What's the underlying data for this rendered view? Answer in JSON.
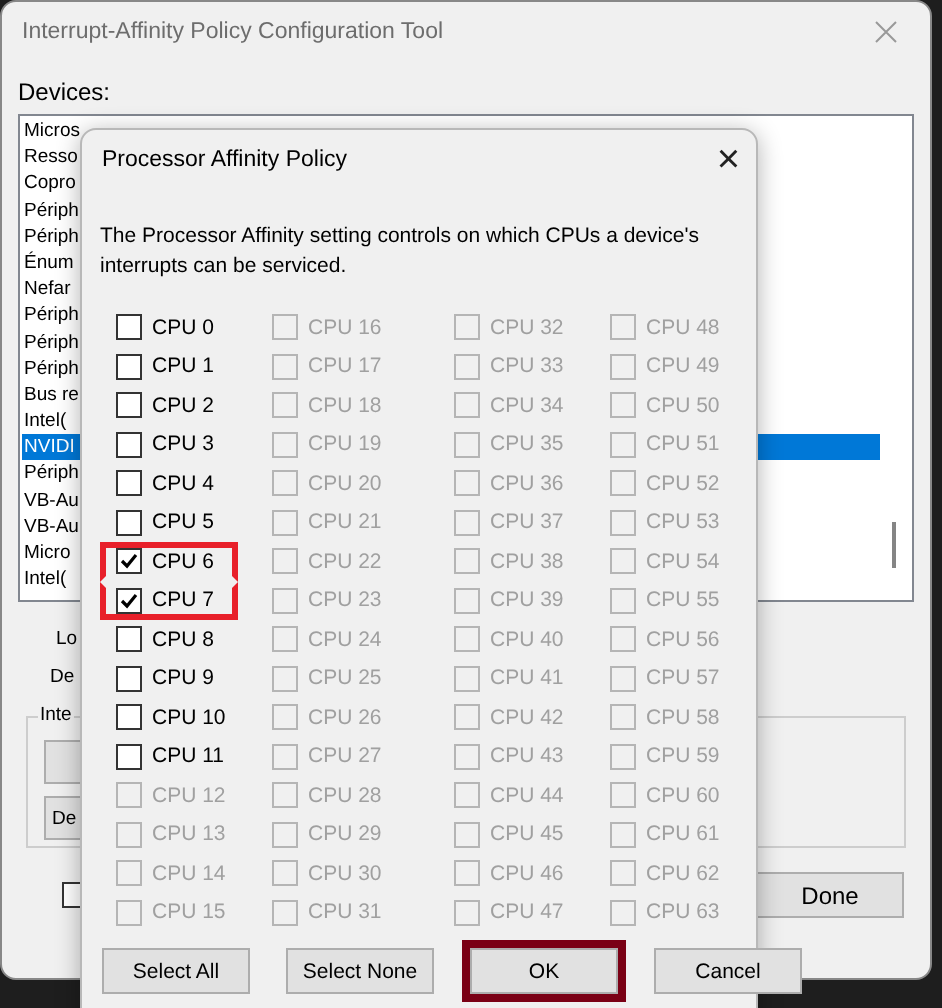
{
  "window": {
    "title": "Interrupt-Affinity Policy Configuration Tool"
  },
  "devices": {
    "label": "Devices:",
    "items": [
      {
        "text": "Micros",
        "selected": false
      },
      {
        "text": "Resso",
        "selected": false
      },
      {
        "text": "Copro",
        "selected": false
      },
      {
        "text": "Périph",
        "selected": false
      },
      {
        "text": "Périph",
        "selected": false
      },
      {
        "text": "Énum",
        "selected": false
      },
      {
        "text": "Nefar",
        "selected": false
      },
      {
        "text": "Périph",
        "selected": false
      },
      {
        "text": "Périph",
        "selected": false
      },
      {
        "text": "Périph",
        "selected": false
      },
      {
        "text": "Bus re",
        "selected": false
      },
      {
        "text": "Intel(",
        "selected": false
      },
      {
        "text": "NVIDI",
        "selected": true
      },
      {
        "text": "Périph",
        "selected": false
      },
      {
        "text": "VB-Au",
        "selected": false
      },
      {
        "text": "VB-Au",
        "selected": false
      },
      {
        "text": "Micro",
        "selected": false
      },
      {
        "text": "Intel(",
        "selected": false
      }
    ]
  },
  "labels": [
    "Lo",
    "De"
  ],
  "group": {
    "legend": "Inte",
    "buttons": [
      {
        "kind": "blank"
      },
      {
        "kind": "text",
        "label": "De"
      }
    ]
  },
  "bottom_checkbox": {
    "checked": false
  },
  "done_button": "Done",
  "dialog": {
    "title": "Processor Affinity Policy",
    "close": "×",
    "description": "The Processor Affinity setting controls on which CPUs a device's interrupts can be serviced.",
    "cpus": [
      {
        "label": "CPU 0",
        "checked": false,
        "disabled": false,
        "highlighted": false
      },
      {
        "label": "CPU 1",
        "checked": false,
        "disabled": false,
        "highlighted": false
      },
      {
        "label": "CPU 2",
        "checked": false,
        "disabled": false,
        "highlighted": false
      },
      {
        "label": "CPU 3",
        "checked": false,
        "disabled": false,
        "highlighted": false
      },
      {
        "label": "CPU 4",
        "checked": false,
        "disabled": false,
        "highlighted": false
      },
      {
        "label": "CPU 5",
        "checked": false,
        "disabled": false,
        "highlighted": false
      },
      {
        "label": "CPU 6",
        "checked": true,
        "disabled": false,
        "highlighted": true
      },
      {
        "label": "CPU 7",
        "checked": true,
        "disabled": false,
        "highlighted": true
      },
      {
        "label": "CPU 8",
        "checked": false,
        "disabled": false,
        "highlighted": false
      },
      {
        "label": "CPU 9",
        "checked": false,
        "disabled": false,
        "highlighted": false
      },
      {
        "label": "CPU 10",
        "checked": false,
        "disabled": false,
        "highlighted": false
      },
      {
        "label": "CPU 11",
        "checked": false,
        "disabled": false,
        "highlighted": false
      },
      {
        "label": "CPU 12",
        "checked": false,
        "disabled": true,
        "highlighted": false
      },
      {
        "label": "CPU 13",
        "checked": false,
        "disabled": true,
        "highlighted": false
      },
      {
        "label": "CPU 14",
        "checked": false,
        "disabled": true,
        "highlighted": false
      },
      {
        "label": "CPU 15",
        "checked": false,
        "disabled": true,
        "highlighted": false
      },
      {
        "label": "CPU 16",
        "checked": false,
        "disabled": true,
        "highlighted": false
      },
      {
        "label": "CPU 17",
        "checked": false,
        "disabled": true,
        "highlighted": false
      },
      {
        "label": "CPU 18",
        "checked": false,
        "disabled": true,
        "highlighted": false
      },
      {
        "label": "CPU 19",
        "checked": false,
        "disabled": true,
        "highlighted": false
      },
      {
        "label": "CPU 20",
        "checked": false,
        "disabled": true,
        "highlighted": false
      },
      {
        "label": "CPU 21",
        "checked": false,
        "disabled": true,
        "highlighted": false
      },
      {
        "label": "CPU 22",
        "checked": false,
        "disabled": true,
        "highlighted": false
      },
      {
        "label": "CPU 23",
        "checked": false,
        "disabled": true,
        "highlighted": false
      },
      {
        "label": "CPU 24",
        "checked": false,
        "disabled": true,
        "highlighted": false
      },
      {
        "label": "CPU 25",
        "checked": false,
        "disabled": true,
        "highlighted": false
      },
      {
        "label": "CPU 26",
        "checked": false,
        "disabled": true,
        "highlighted": false
      },
      {
        "label": "CPU 27",
        "checked": false,
        "disabled": true,
        "highlighted": false
      },
      {
        "label": "CPU 28",
        "checked": false,
        "disabled": true,
        "highlighted": false
      },
      {
        "label": "CPU 29",
        "checked": false,
        "disabled": true,
        "highlighted": false
      },
      {
        "label": "CPU 30",
        "checked": false,
        "disabled": true,
        "highlighted": false
      },
      {
        "label": "CPU 31",
        "checked": false,
        "disabled": true,
        "highlighted": false
      },
      {
        "label": "CPU 32",
        "checked": false,
        "disabled": true,
        "highlighted": false
      },
      {
        "label": "CPU 33",
        "checked": false,
        "disabled": true,
        "highlighted": false
      },
      {
        "label": "CPU 34",
        "checked": false,
        "disabled": true,
        "highlighted": false
      },
      {
        "label": "CPU 35",
        "checked": false,
        "disabled": true,
        "highlighted": false
      },
      {
        "label": "CPU 36",
        "checked": false,
        "disabled": true,
        "highlighted": false
      },
      {
        "label": "CPU 37",
        "checked": false,
        "disabled": true,
        "highlighted": false
      },
      {
        "label": "CPU 38",
        "checked": false,
        "disabled": true,
        "highlighted": false
      },
      {
        "label": "CPU 39",
        "checked": false,
        "disabled": true,
        "highlighted": false
      },
      {
        "label": "CPU 40",
        "checked": false,
        "disabled": true,
        "highlighted": false
      },
      {
        "label": "CPU 41",
        "checked": false,
        "disabled": true,
        "highlighted": false
      },
      {
        "label": "CPU 42",
        "checked": false,
        "disabled": true,
        "highlighted": false
      },
      {
        "label": "CPU 43",
        "checked": false,
        "disabled": true,
        "highlighted": false
      },
      {
        "label": "CPU 44",
        "checked": false,
        "disabled": true,
        "highlighted": false
      },
      {
        "label": "CPU 45",
        "checked": false,
        "disabled": true,
        "highlighted": false
      },
      {
        "label": "CPU 46",
        "checked": false,
        "disabled": true,
        "highlighted": false
      },
      {
        "label": "CPU 47",
        "checked": false,
        "disabled": true,
        "highlighted": false
      },
      {
        "label": "CPU 48",
        "checked": false,
        "disabled": true,
        "highlighted": false
      },
      {
        "label": "CPU 49",
        "checked": false,
        "disabled": true,
        "highlighted": false
      },
      {
        "label": "CPU 50",
        "checked": false,
        "disabled": true,
        "highlighted": false
      },
      {
        "label": "CPU 51",
        "checked": false,
        "disabled": true,
        "highlighted": false
      },
      {
        "label": "CPU 52",
        "checked": false,
        "disabled": true,
        "highlighted": false
      },
      {
        "label": "CPU 53",
        "checked": false,
        "disabled": true,
        "highlighted": false
      },
      {
        "label": "CPU 54",
        "checked": false,
        "disabled": true,
        "highlighted": false
      },
      {
        "label": "CPU 55",
        "checked": false,
        "disabled": true,
        "highlighted": false
      },
      {
        "label": "CPU 56",
        "checked": false,
        "disabled": true,
        "highlighted": false
      },
      {
        "label": "CPU 57",
        "checked": false,
        "disabled": true,
        "highlighted": false
      },
      {
        "label": "CPU 58",
        "checked": false,
        "disabled": true,
        "highlighted": false
      },
      {
        "label": "CPU 59",
        "checked": false,
        "disabled": true,
        "highlighted": false
      },
      {
        "label": "CPU 60",
        "checked": false,
        "disabled": true,
        "highlighted": false
      },
      {
        "label": "CPU 61",
        "checked": false,
        "disabled": true,
        "highlighted": false
      },
      {
        "label": "CPU 62",
        "checked": false,
        "disabled": true,
        "highlighted": false
      },
      {
        "label": "CPU 63",
        "checked": false,
        "disabled": true,
        "highlighted": false
      }
    ],
    "buttons": [
      {
        "label": "Select All",
        "highlighted": false
      },
      {
        "label": "Select None",
        "highlighted": false
      },
      {
        "label": "OK",
        "highlighted": true
      },
      {
        "label": "Cancel",
        "highlighted": false
      }
    ]
  }
}
